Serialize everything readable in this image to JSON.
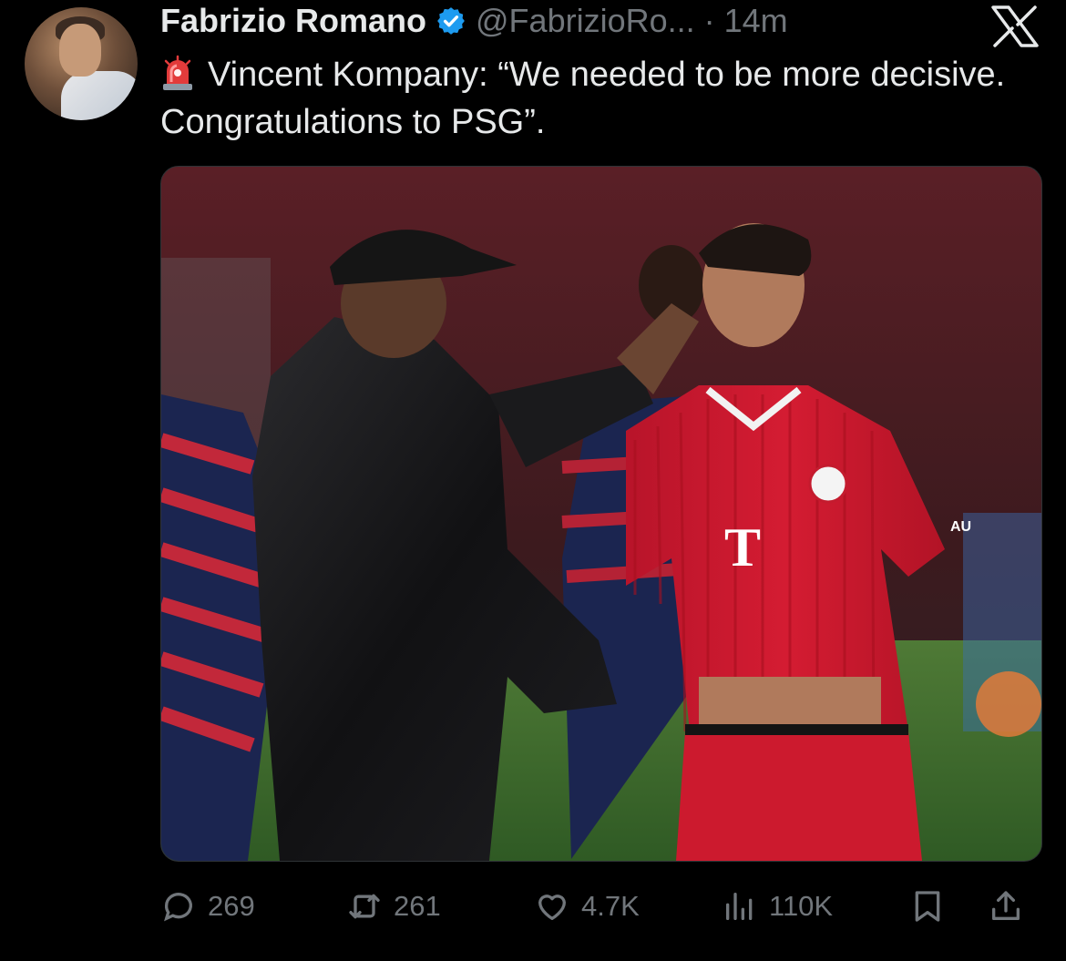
{
  "post": {
    "author": {
      "name": "Fabrizio Romano",
      "handle": "@FabrizioRo...",
      "verified": true
    },
    "separator": "·",
    "time": "14m",
    "text": "Vincent Kompany: “We needed to be more decisive. Congratulations to PSG”.",
    "leading_icon": "siren-emoji",
    "media": {
      "kind": "photo",
      "jersey_letter": "T",
      "jersey_sponsor": "AU"
    }
  },
  "actions": {
    "replies": "269",
    "reposts": "261",
    "likes": "4.7K",
    "views": "110K"
  },
  "icons": {
    "platform": "x-logo",
    "reply": "reply-icon",
    "repost": "repost-icon",
    "like": "heart-icon",
    "views": "views-icon",
    "bookmark": "bookmark-icon",
    "share": "share-icon"
  },
  "colors": {
    "background": "#000000",
    "text": "#e7e9ea",
    "muted": "#71767b",
    "verified": "#1d9bf0",
    "jersey": "#d1172b"
  }
}
